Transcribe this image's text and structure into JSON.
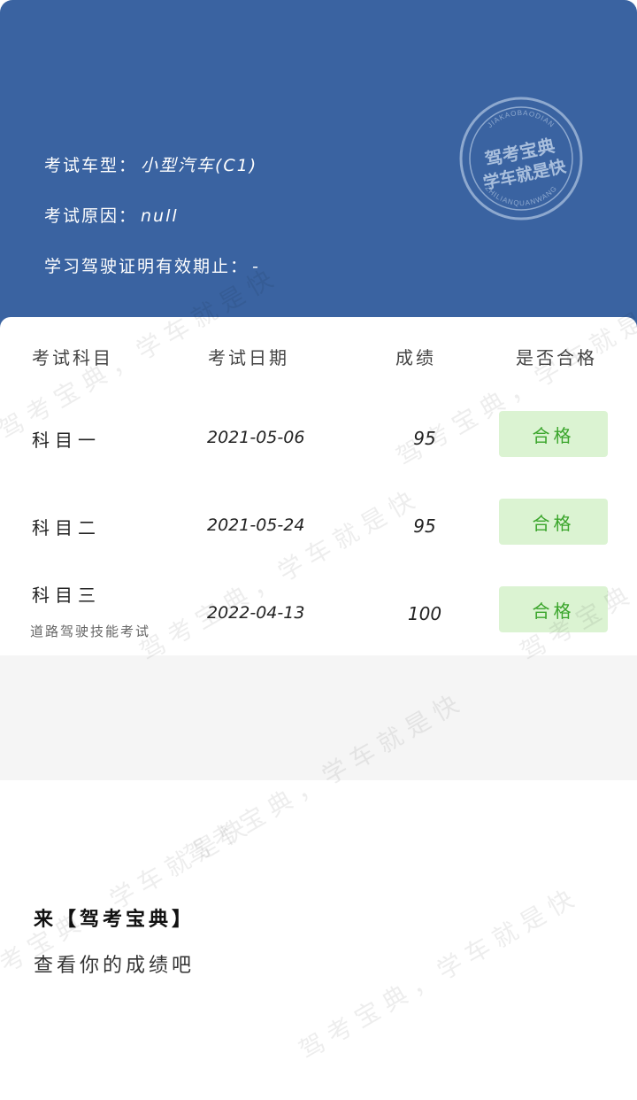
{
  "header": {
    "info": [
      {
        "label": "考试车型：",
        "value": "小型汽车(C1)"
      },
      {
        "label": "考试原因：",
        "value": "null"
      },
      {
        "label": "学习驾驶证明有效期止：",
        "value": "-"
      }
    ],
    "stamp": {
      "top_text": "JIAKAOBAODIAN",
      "line1": "驾考宝典",
      "line2": "学车就是快",
      "bottom_text": "ZHILIANQUANWANG",
      "color": "#8ea9cf"
    }
  },
  "table": {
    "headers": [
      "考试科目",
      "考试日期",
      "成绩",
      "是否合格"
    ],
    "rows": [
      {
        "subject": "科目一",
        "note": "",
        "date": "2021-05-06",
        "score": "95",
        "result": "合格"
      },
      {
        "subject": "科目二",
        "note": "",
        "date": "2021-05-24",
        "score": "95",
        "result": "合格"
      },
      {
        "subject": "科目三",
        "note": "道路驾驶技能考试",
        "date": "2022-04-13",
        "score": "100",
        "result": "合格"
      }
    ]
  },
  "promo": {
    "line1": "来【驾考宝典】",
    "line2": "查看你的成绩吧"
  },
  "watermark": "驾考宝典，学车就是快",
  "colors": {
    "header_bg": "#3a63a1",
    "pass_bg": "#dbf3d2",
    "pass_text": "#3aa52b"
  }
}
